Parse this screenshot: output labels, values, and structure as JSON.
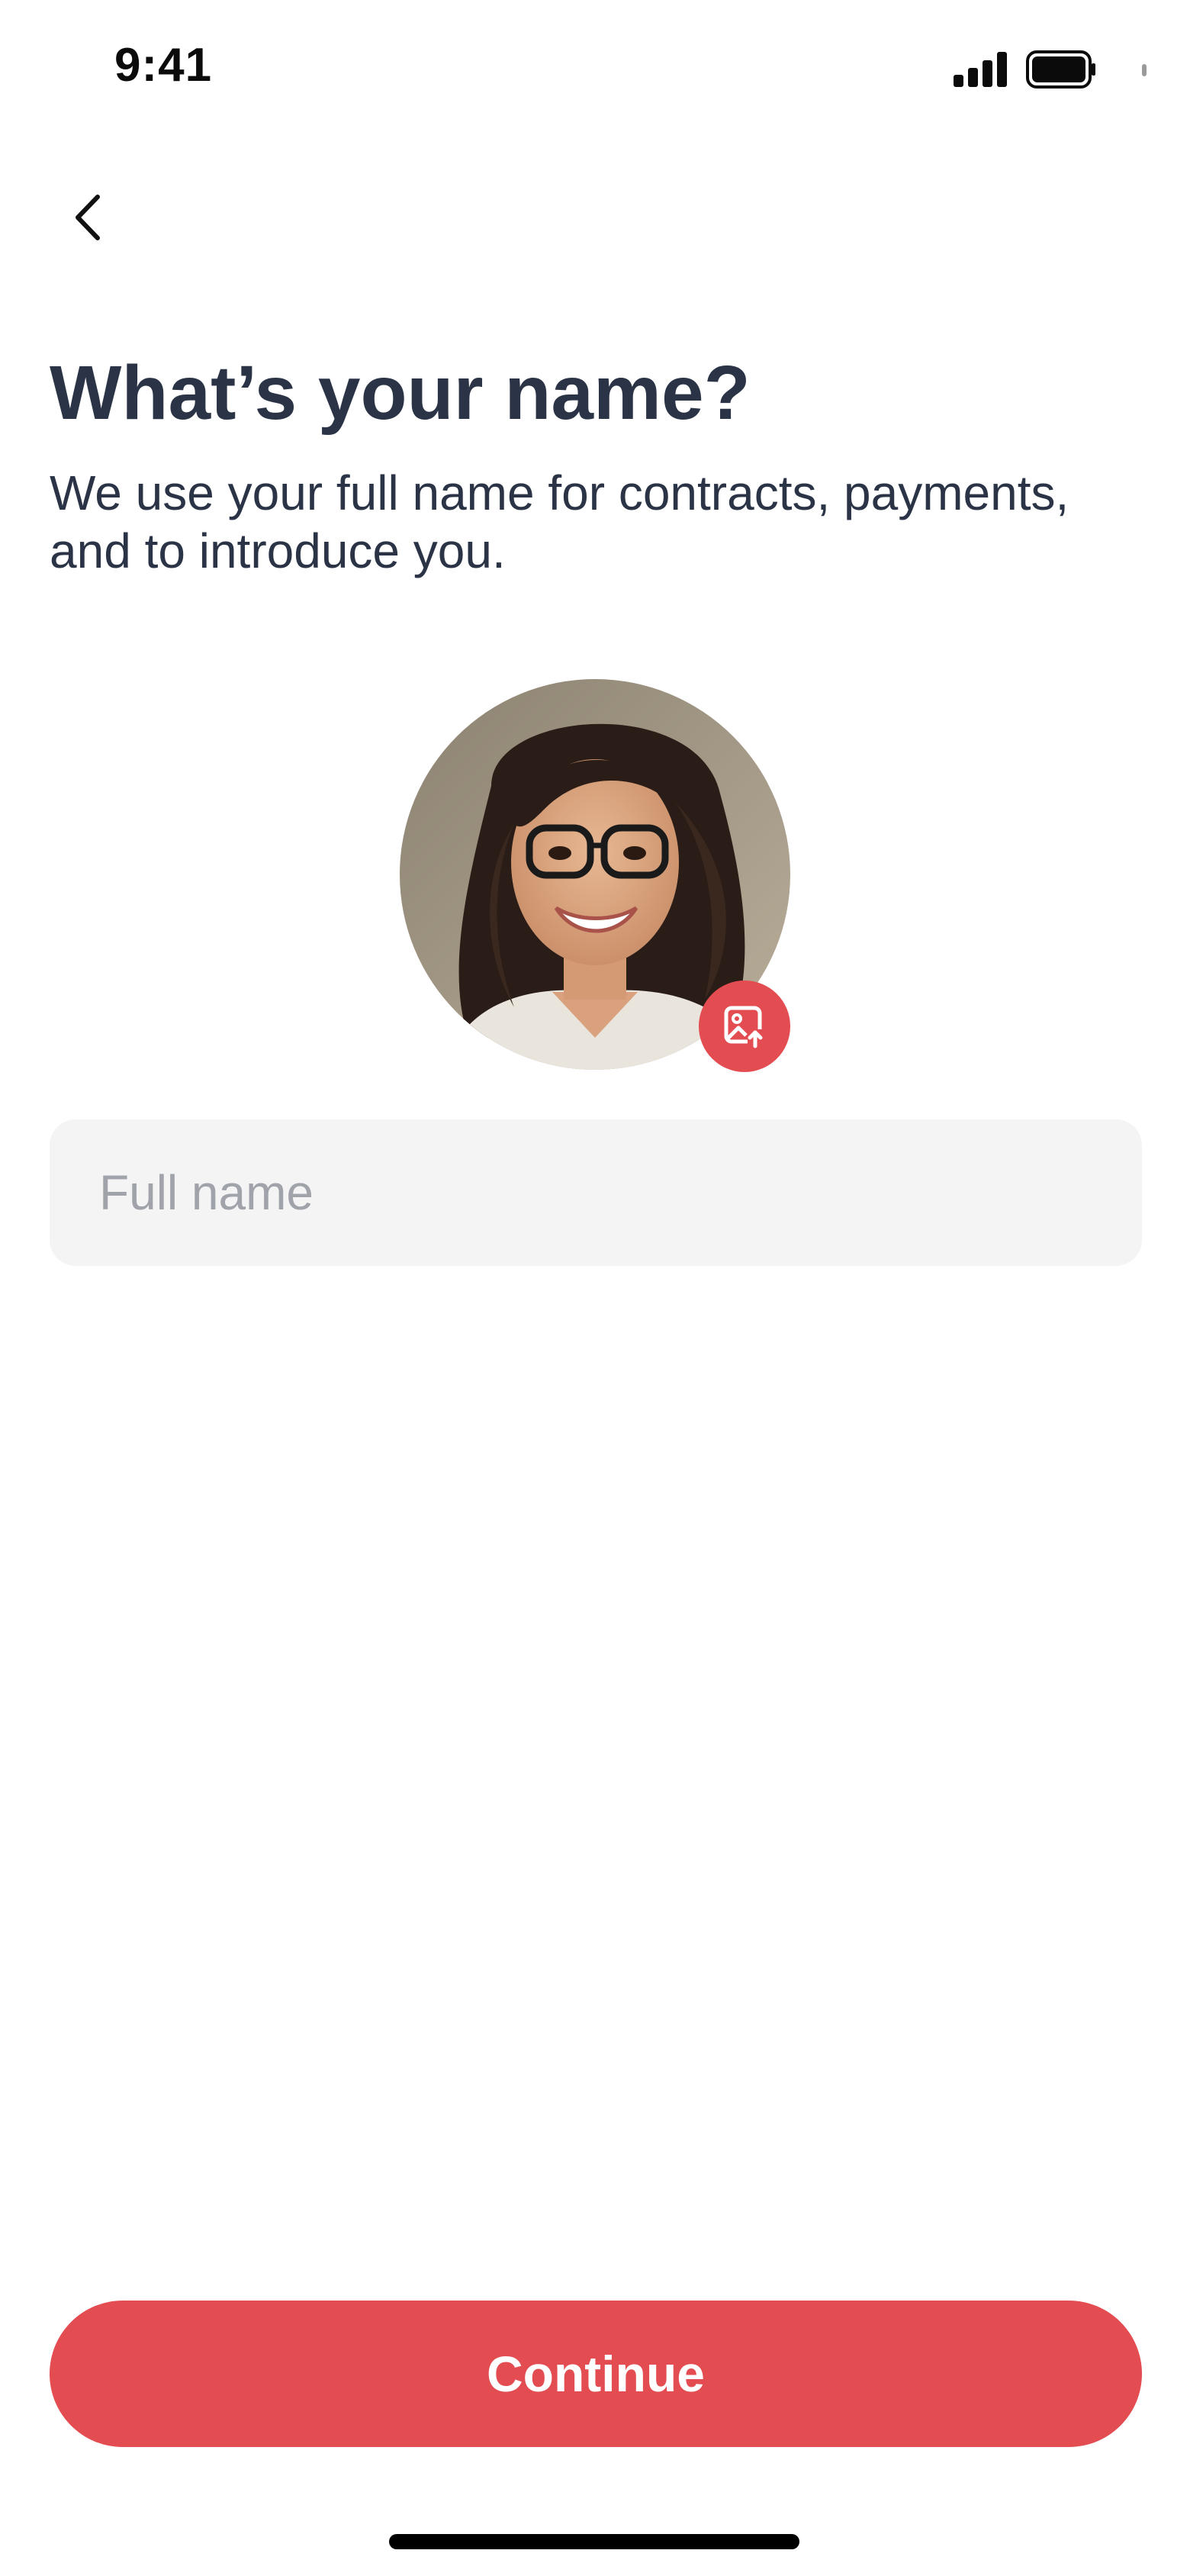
{
  "status_bar": {
    "time": "9:41",
    "signal_icon": "cellular-signal-icon",
    "battery_icon": "battery-full-icon"
  },
  "header": {
    "back_icon": "chevron-left-icon"
  },
  "content": {
    "title": "What’s your name?",
    "subtitle": "We use your full name for contracts, payments, and to introduce you."
  },
  "avatar": {
    "upload_icon": "image-upload-icon"
  },
  "name_input": {
    "placeholder": "Full name",
    "value": ""
  },
  "footer": {
    "continue_label": "Continue"
  },
  "colors": {
    "accent": "#e34c50",
    "text": "#2b3446",
    "placeholder": "#a0a3aa",
    "field_bg": "#f4f4f5"
  }
}
